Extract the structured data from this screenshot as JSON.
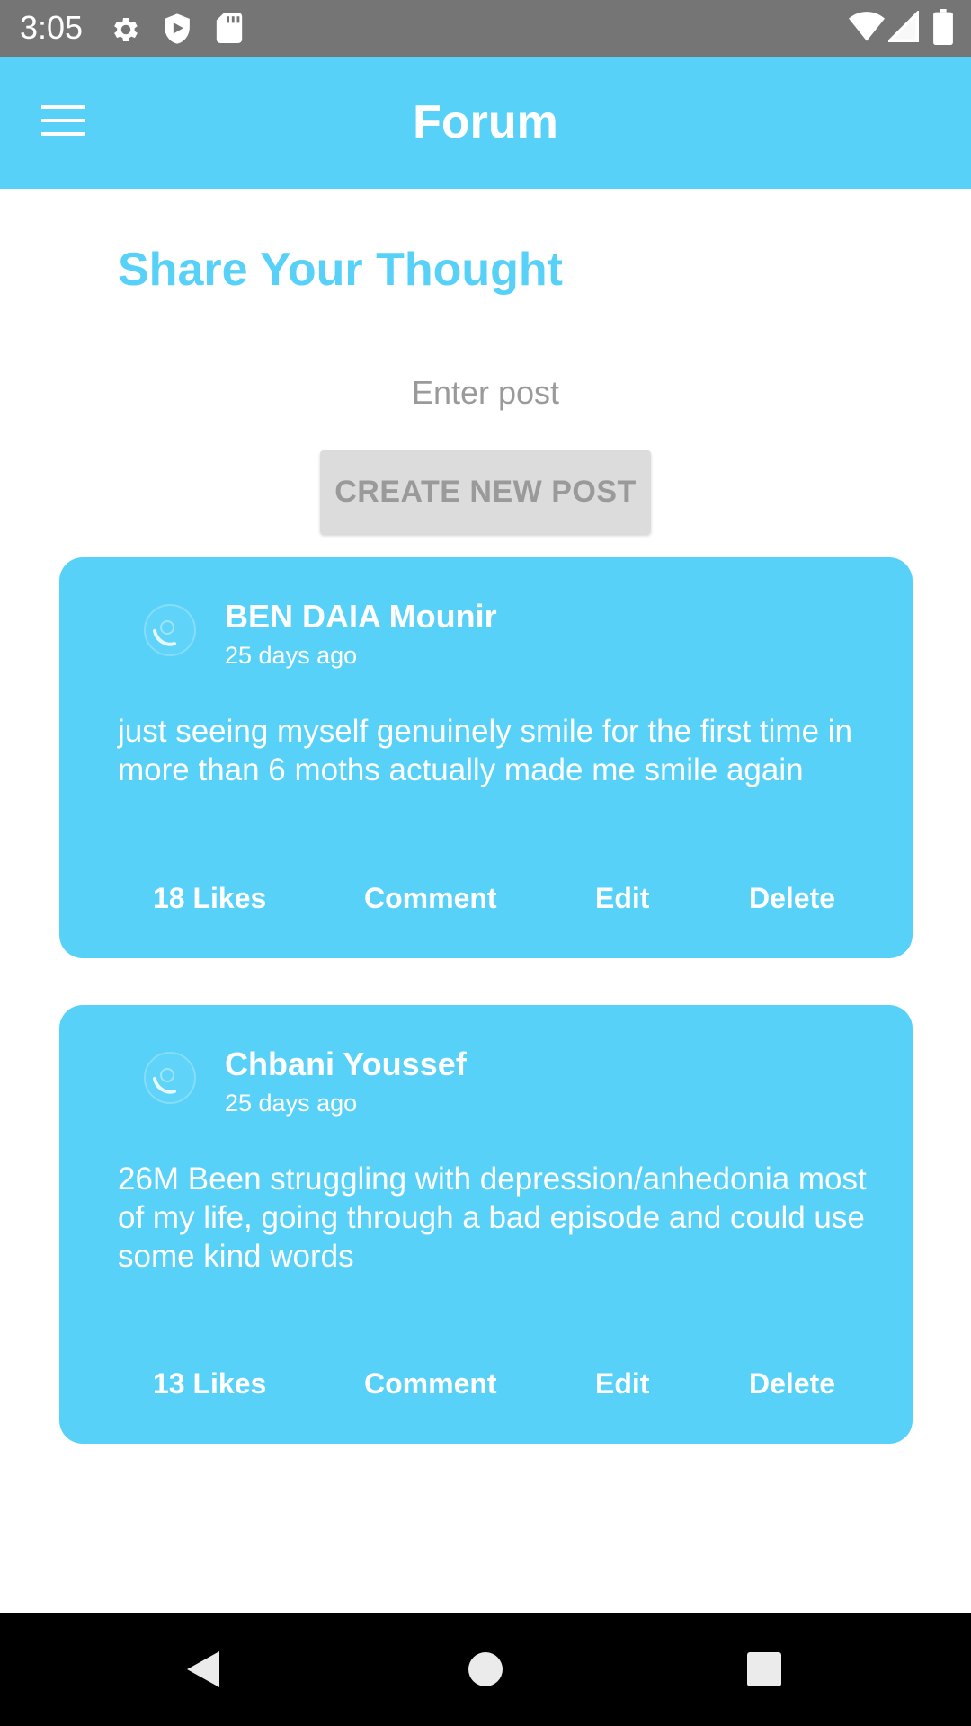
{
  "status_bar": {
    "time": "3:05",
    "left_icons": [
      "settings-icon",
      "shield-icon",
      "sd-card-icon"
    ],
    "right_icons": [
      "wifi-icon",
      "signal-icon",
      "battery-icon"
    ]
  },
  "app_bar": {
    "title": "Forum",
    "menu_icon": "hamburger-menu-icon"
  },
  "composer": {
    "heading": "Share Your Thought",
    "input_placeholder": "Enter post",
    "input_value": "",
    "create_button": "CREATE NEW POST"
  },
  "posts": [
    {
      "author": "BEN DAIA Mounir",
      "time": "25 days ago",
      "body": "just seeing myself genuinely smile for the first time in more than 6 moths actually made me smile again",
      "likes": "18 Likes",
      "comment": "Comment",
      "edit": "Edit",
      "delete": "Delete"
    },
    {
      "author": "Chbani Youssef",
      "time": "25 days ago",
      "body": "26M Been struggling with depression/anhedonia most of my life, going through a bad episode and could use some kind words",
      "likes": "13 Likes",
      "comment": "Comment",
      "edit": "Edit",
      "delete": "Delete"
    }
  ],
  "nav_bar": {
    "buttons": [
      "back-icon",
      "home-icon",
      "recents-icon"
    ]
  },
  "colors": {
    "accent": "#58d1f8",
    "status_bar": "#757575",
    "button_disabled": "#dcdcdc",
    "nav_bar": "#000000"
  }
}
